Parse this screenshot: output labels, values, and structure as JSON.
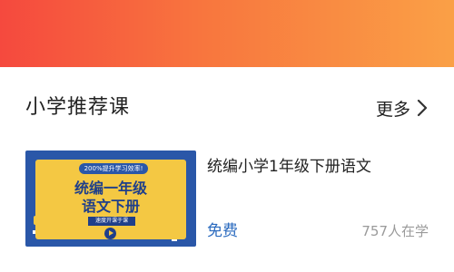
{
  "banner": {
    "gradient_colors": [
      "#f5493e",
      "#f8763e",
      "#faa046"
    ]
  },
  "section": {
    "title": "小学推荐课",
    "more_label": "更多"
  },
  "course": {
    "thumbnail": {
      "promo_text": "200%提升学习效率!",
      "title_line1": "统编一年级",
      "title_line2": "语文下册",
      "tag_text": "速度开课于课",
      "background_color": "#2a57a8",
      "panel_color": "#f4c843"
    },
    "name": "统编小学1年级下册语文",
    "price": "免费",
    "learners": "757人在学",
    "price_color": "#2b6bbf"
  }
}
